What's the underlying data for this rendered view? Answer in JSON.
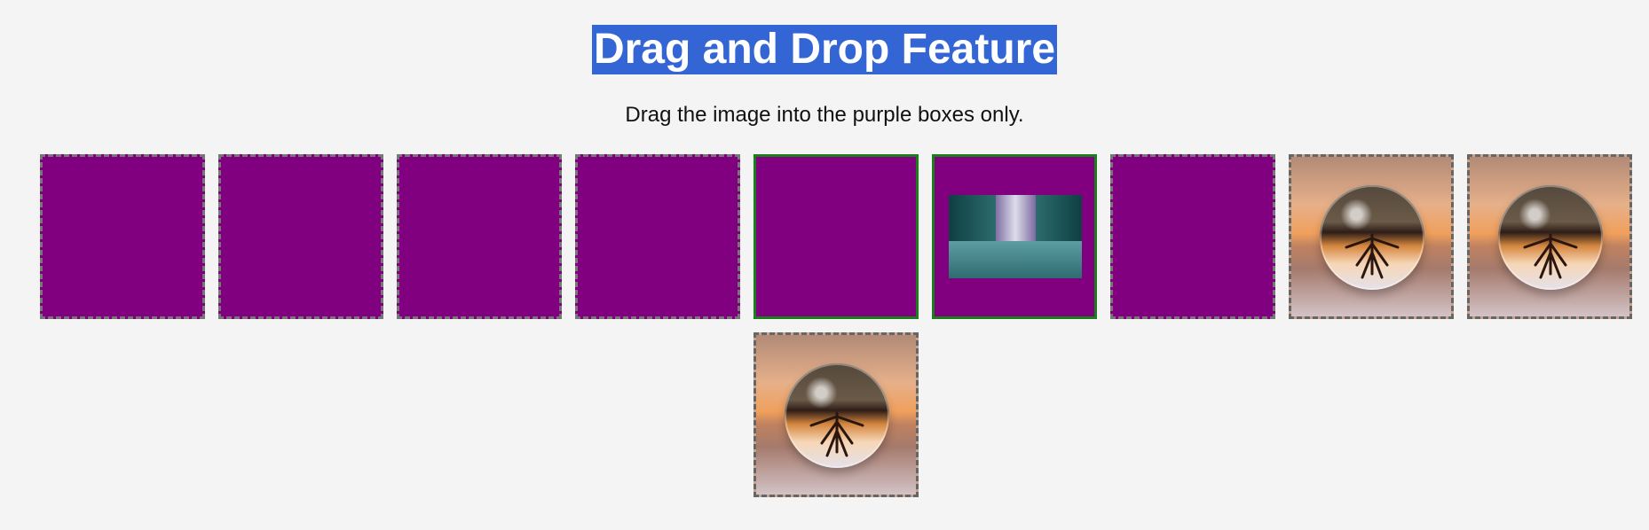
{
  "header": {
    "title": "Drag and Drop Feature",
    "instruction": "Drag the image into the purple boxes only."
  },
  "colors": {
    "title_bg": "#3465d4",
    "drop_box": "#800080",
    "active_border": "#1a7f1a",
    "page_bg": "#f4f4f4"
  },
  "boxes": [
    {
      "kind": "drop-target",
      "state": "empty"
    },
    {
      "kind": "drop-target",
      "state": "empty"
    },
    {
      "kind": "drop-target",
      "state": "empty"
    },
    {
      "kind": "drop-target",
      "state": "empty"
    },
    {
      "kind": "drop-target",
      "state": "highlighted-empty"
    },
    {
      "kind": "drop-target",
      "state": "highlighted-with-city-image"
    },
    {
      "kind": "drop-target",
      "state": "empty"
    },
    {
      "kind": "draggable-image",
      "image": "crystal-ball-tree"
    },
    {
      "kind": "draggable-image",
      "image": "crystal-ball-tree"
    },
    {
      "kind": "draggable-image",
      "image": "crystal-ball-tree"
    }
  ]
}
